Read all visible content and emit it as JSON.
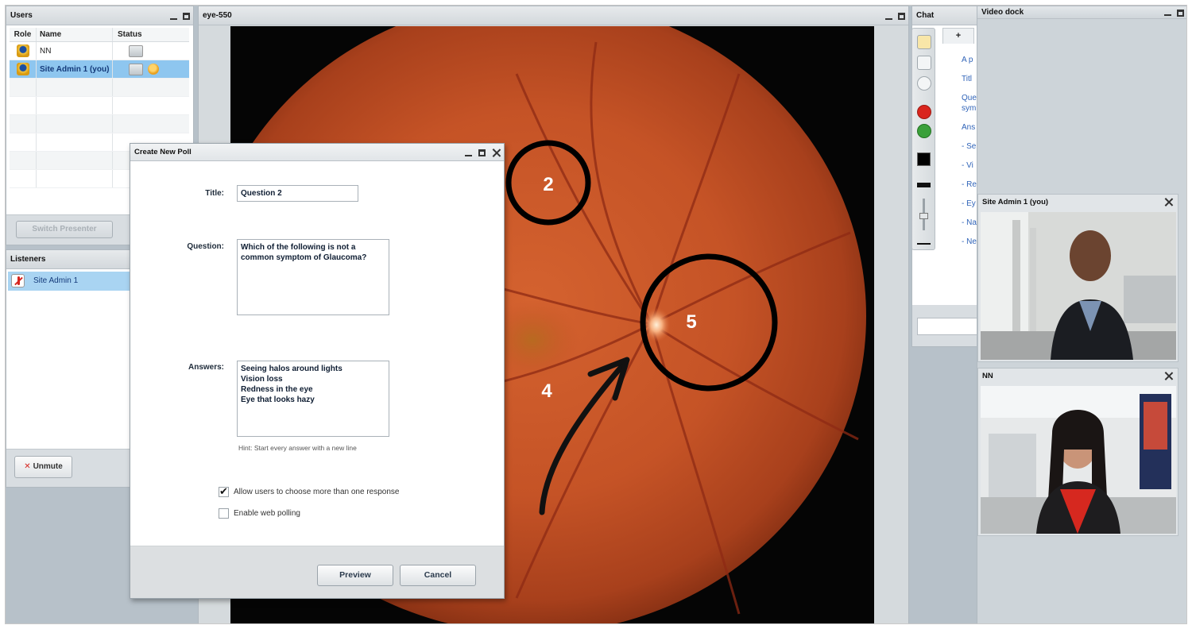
{
  "users_panel": {
    "title": "Users",
    "columns": [
      "Role",
      "Name",
      "Status"
    ],
    "rows": [
      {
        "name": "NN"
      },
      {
        "name": "Site Admin 1 (you)"
      }
    ],
    "switch_presenter_label": "Switch Presenter"
  },
  "listeners_panel": {
    "title": "Listeners",
    "items": [
      {
        "name": "Site Admin 1"
      }
    ],
    "unmute_label": "Unmute"
  },
  "presentation": {
    "title": "eye-550",
    "annotations": [
      "2",
      "5",
      "4"
    ]
  },
  "poll_dialog": {
    "title": "Create New Poll",
    "title_label": "Title:",
    "title_value": "Question 2",
    "question_label": "Question:",
    "question_value": "Which of the following is not a\ncommon symptom of Glaucoma?",
    "answers_label": "Answers:",
    "answers_value": "Seeing halos around lights\nVision loss\nRedness in the eye\nEye that looks hazy",
    "hint": "Hint: Start every answer with a new line",
    "multi_response_label": "Allow users to choose more than one response",
    "multi_response_checked": true,
    "web_polling_label": "Enable web polling",
    "web_polling_checked": false,
    "preview_label": "Preview",
    "cancel_label": "Cancel"
  },
  "chat_panel": {
    "title": "Chat",
    "add_tab_label": "+",
    "messages": [
      "A p",
      "Titl",
      "Que",
      "sym",
      "Ans",
      "- Se",
      "- Vi",
      "- Re",
      "- Ey",
      "- Na",
      "- Ne"
    ]
  },
  "video_dock": {
    "title": "Video dock",
    "tiles": [
      {
        "name": "Site Admin 1 (you)"
      },
      {
        "name": "NN"
      }
    ]
  },
  "colors": {
    "selected_row": "#8ec6ef",
    "link_blue": "#2f63b8",
    "annotation_black": "#000000",
    "fundus_orange": "#c0502a"
  }
}
